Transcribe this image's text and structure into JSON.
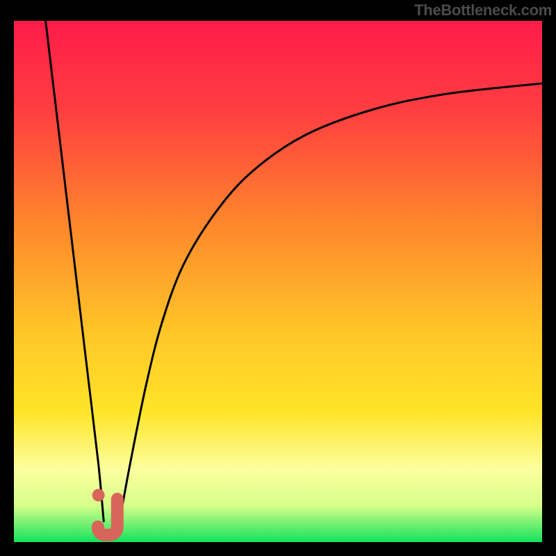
{
  "watermark": "TheBottleneck.com",
  "colors": {
    "frame_bg": "#000000",
    "gradient_top": "#ff1b4a",
    "gradient_mid1": "#ff8a2b",
    "gradient_mid2": "#ffe428",
    "gradient_low": "#fcff9e",
    "gradient_bottom": "#12e25b",
    "curve_stroke": "#000000",
    "marker_fill": "#d9645a",
    "watermark_color": "#4b4b4b"
  },
  "chart_data": {
    "type": "line",
    "title": "",
    "xlabel": "",
    "ylabel": "",
    "xlim": [
      0,
      100
    ],
    "ylim": [
      0,
      100
    ],
    "grid": false,
    "legend": false,
    "background": "vertical-gradient (red top → orange → yellow → pale yellow → green bottom)",
    "series": [
      {
        "name": "left-branch",
        "description": "near-linear descending segment from top-left toward bottom notch",
        "x": [
          6,
          8,
          10,
          12,
          14,
          16,
          17
        ],
        "y": [
          100,
          83,
          66,
          49,
          32,
          15,
          4
        ]
      },
      {
        "name": "right-branch",
        "description": "rising concave curve from bottom notch toward upper right",
        "x": [
          20,
          22,
          25,
          28,
          32,
          38,
          45,
          55,
          68,
          82,
          100
        ],
        "y": [
          4,
          15,
          30,
          42,
          53,
          63,
          71,
          78,
          83,
          86,
          88
        ]
      }
    ],
    "annotations": [
      {
        "name": "j-marker",
        "description": "small J-shaped pink marker at the valley bottom",
        "approx_x": 18,
        "approx_y": 4,
        "color": "#d9645a"
      },
      {
        "name": "dot-marker",
        "description": "small pink dot just above and left of the J marker",
        "approx_x": 16,
        "approx_y": 9,
        "color": "#d9645a"
      }
    ]
  }
}
